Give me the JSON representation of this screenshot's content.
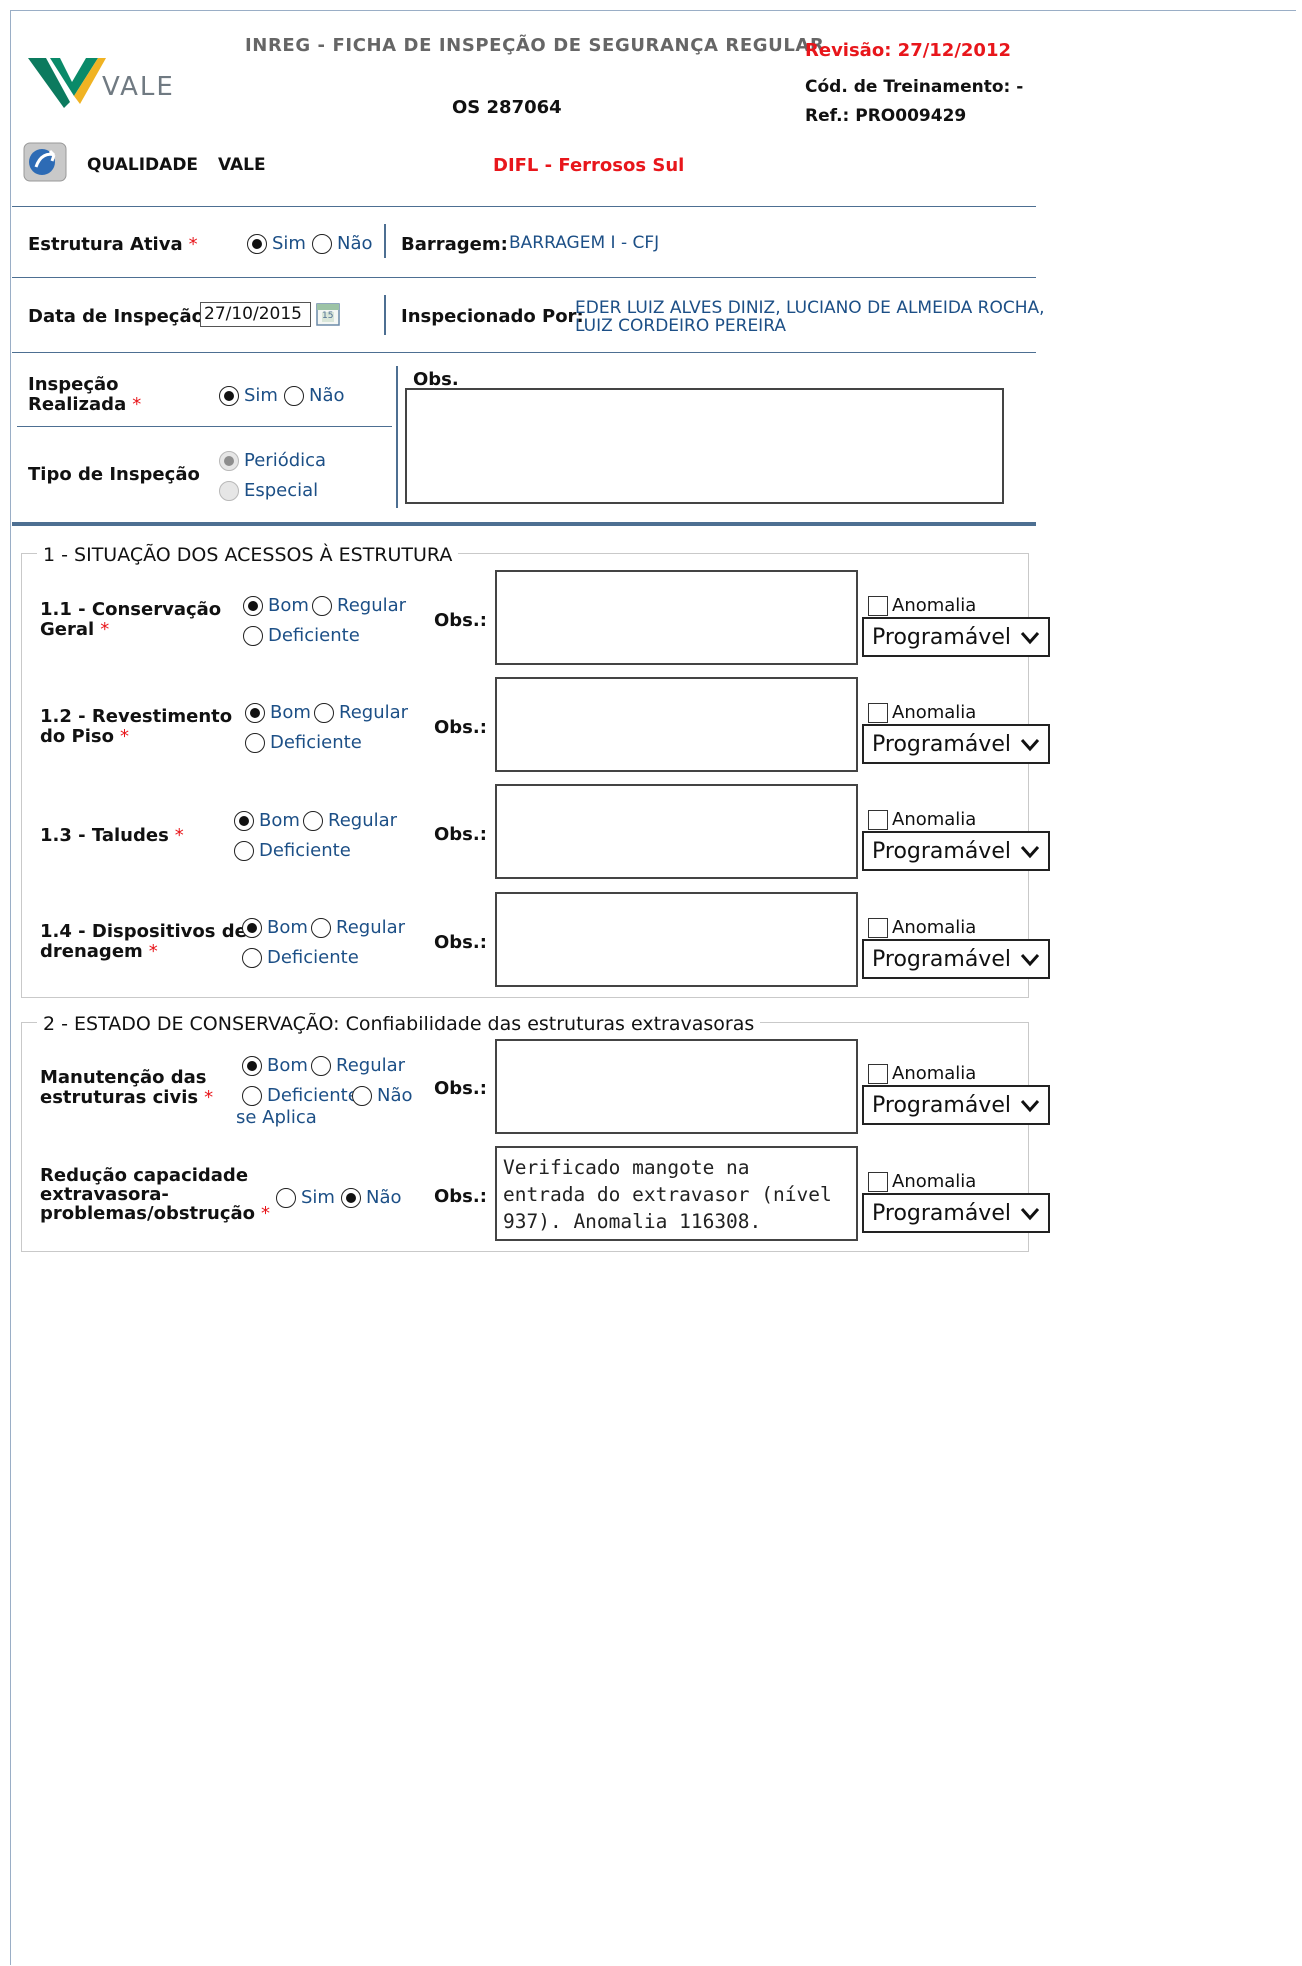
{
  "header": {
    "title": "INREG - FICHA DE INSPEÇÃO DE SEGURANÇA REGULAR",
    "os": "OS 287064",
    "revisao": "Revisão: 27/12/2012",
    "cod_treinamento": "Cód. de Treinamento: -",
    "ref": "Ref.: PRO009429",
    "logo_text": "VALE",
    "qualidade": "QUALIDADE",
    "qualidade_vale": "VALE",
    "unidade": "DIFL - Ferrosos Sul"
  },
  "colors": {
    "accent_red": "#e8161b",
    "value_blue": "#1c4f86",
    "rule": "#4d6f92",
    "vale_green": "#0c7a5e",
    "vale_yellow": "#f0b323"
  },
  "estrutura": {
    "label": "Estrutura Ativa",
    "required": "*",
    "options": [
      "Sim",
      "Não"
    ],
    "selected": "Sim",
    "barragem_label": "Barragem:",
    "barragem_value": "BARRAGEM I - CFJ"
  },
  "inspecao": {
    "data_label": "Data de Inspeção",
    "data_value": "27/10/2015",
    "calendar_icon_text": "15",
    "inspecionado_label": "Inspecionado Por:",
    "inspecionado_line1": "EDER LUIZ ALVES DINIZ, LUCIANO DE ALMEIDA ROCHA,",
    "inspecionado_line2": "LUIZ CORDEIRO PEREIRA",
    "realizada_label_1": "Inspeção",
    "realizada_label_2": "Realizada",
    "realizada_options": [
      "Sim",
      "Não"
    ],
    "realizada_selected": "Sim",
    "obs_label": "Obs.",
    "tipo_label": "Tipo de Inspeção",
    "tipo_options": [
      "Periódica",
      "Especial"
    ],
    "tipo_selected": "Periódica"
  },
  "common": {
    "obs_label": "Obs.:",
    "anomalia_label": "Anomalia",
    "programavel": "Programável",
    "opt_bom": "Bom",
    "opt_regular": "Regular",
    "opt_deficiente": "Deficiente",
    "opt_nao": "Não",
    "opt_se_aplica": "se Aplica",
    "opt_sim": "Sim"
  },
  "section1": {
    "legend": "1 - SITUAÇÃO DOS ACESSOS À ESTRUTURA",
    "items": [
      {
        "label_1": "1.1 - Conservação",
        "label_2": "Geral",
        "selected": "Bom",
        "obs": ""
      },
      {
        "label_1": "1.2 - Revestimento",
        "label_2": "do Piso",
        "selected": "Bom",
        "obs": ""
      },
      {
        "label_1": "1.3 - Taludes",
        "label_2": "",
        "selected": "Bom",
        "obs": ""
      },
      {
        "label_1": "1.4 - Dispositivos de",
        "label_2": "drenagem",
        "selected": "Bom",
        "obs": ""
      }
    ]
  },
  "section2": {
    "legend": "2 - ESTADO DE CONSERVAÇÃO: Confiabilidade das estruturas extravasoras",
    "items": [
      {
        "label_1": "Manutenção das",
        "label_2": "estruturas civis",
        "selected": "Bom",
        "obs": ""
      },
      {
        "label_1": "Redução capacidade",
        "label_2": "extravasora-",
        "label_3": "problemas/obstrução",
        "selected": "Não",
        "obs": "Verificado mangote na\nentrada do extravasor (nível\n937). Anomalia 116308."
      }
    ]
  }
}
